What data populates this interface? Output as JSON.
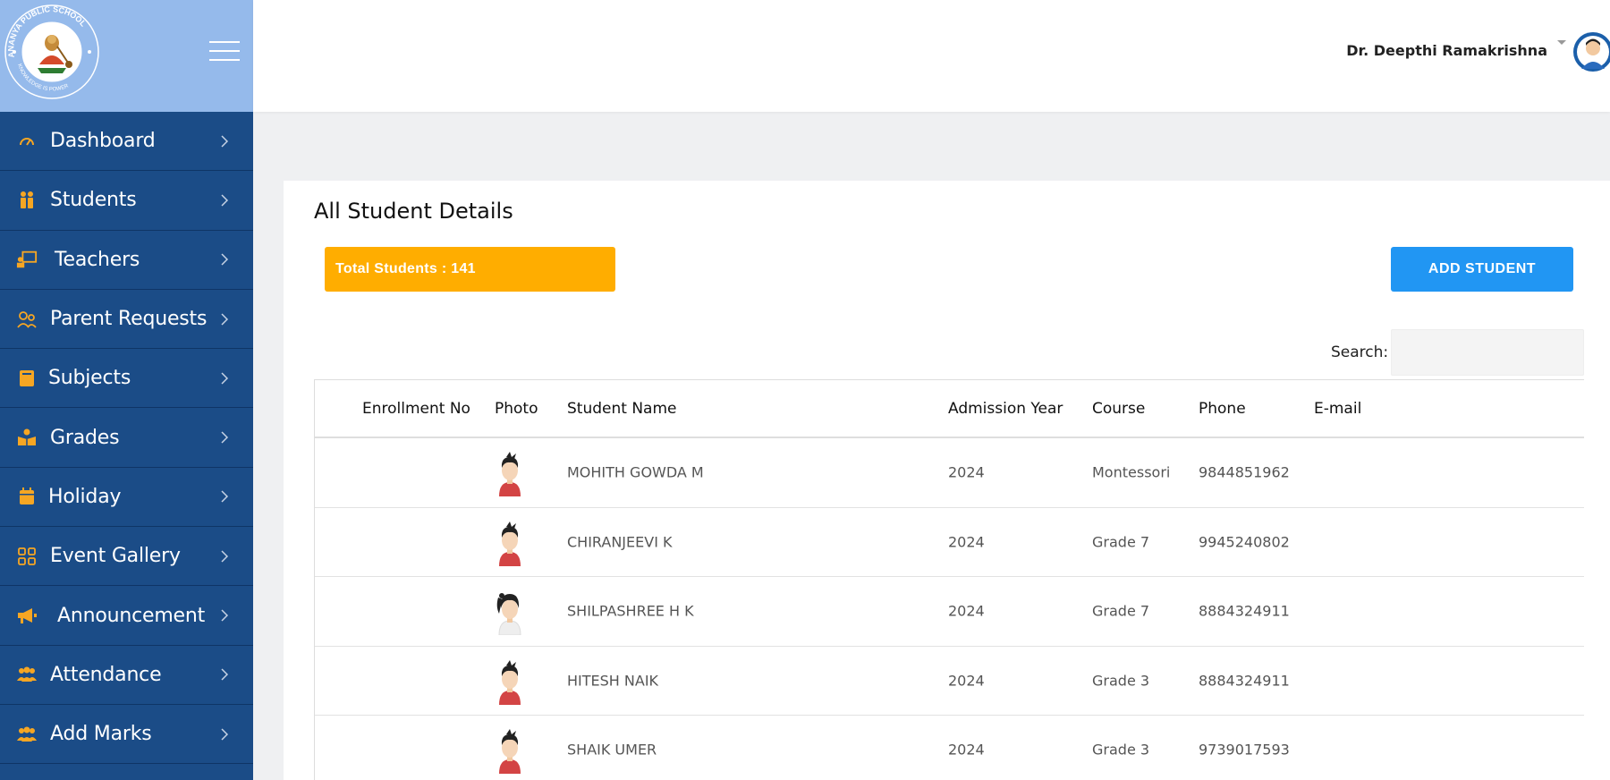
{
  "colors": {
    "sidebar": "#1b4c87",
    "sidebar_header": "#95baeb",
    "menu_icon": "#f6a623",
    "badge": "#ffad00",
    "primary_button": "#2196f3"
  },
  "logo": {
    "school_name": "ANANYA PUBLIC SCHOOL",
    "motto": "KNOWLEDGE IS POWER",
    "location": "DODDABYALAKERE, B'LORE-89"
  },
  "sidebar": {
    "items": [
      {
        "label": "Dashboard",
        "icon": "speedometer-icon"
      },
      {
        "label": "Students",
        "icon": "students-icon"
      },
      {
        "label": "Teachers",
        "icon": "teacher-board-icon"
      },
      {
        "label": "Parent Requests",
        "icon": "parents-icon"
      },
      {
        "label": "Subjects",
        "icon": "book-icon"
      },
      {
        "label": "Grades",
        "icon": "reader-icon"
      },
      {
        "label": "Holiday",
        "icon": "calendar-icon"
      },
      {
        "label": "Event Gallery",
        "icon": "grid-icon"
      },
      {
        "label": "Announcement",
        "icon": "megaphone-icon"
      },
      {
        "label": "Attendance",
        "icon": "users-icon"
      },
      {
        "label": "Add Marks",
        "icon": "users-icon"
      }
    ]
  },
  "header": {
    "user_name": "Dr. Deepthi Ramakrishna"
  },
  "main": {
    "title": "All Student Details",
    "total_label": "Total Students : 141",
    "add_button": "ADD STUDENT",
    "search_label": "Search:",
    "search_value": "",
    "columns": [
      "Enrollment No",
      "Photo",
      "Student Name",
      "Admission Year",
      "Course",
      "Phone",
      "E-mail"
    ],
    "rows": [
      {
        "enrollment": "",
        "photo": "boy-avatar",
        "name": "MOHITH GOWDA M",
        "year": "2024",
        "course": "Montessori",
        "phone": "9844851962",
        "email": ""
      },
      {
        "enrollment": "",
        "photo": "boy-avatar",
        "name": "CHIRANJEEVI K",
        "year": "2024",
        "course": "Grade 7",
        "phone": "9945240802",
        "email": ""
      },
      {
        "enrollment": "",
        "photo": "girl-avatar",
        "name": "SHILPASHREE H K",
        "year": "2024",
        "course": "Grade 7",
        "phone": "8884324911",
        "email": ""
      },
      {
        "enrollment": "",
        "photo": "boy-avatar",
        "name": "HITESH NAIK",
        "year": "2024",
        "course": "Grade 3",
        "phone": "8884324911",
        "email": ""
      },
      {
        "enrollment": "",
        "photo": "boy-avatar",
        "name": "SHAIK UMER",
        "year": "2024",
        "course": "Grade 3",
        "phone": "9739017593",
        "email": ""
      }
    ]
  }
}
